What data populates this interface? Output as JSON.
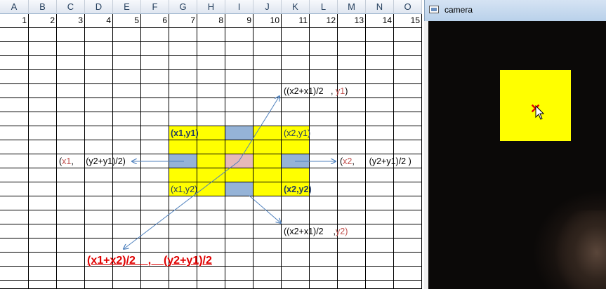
{
  "spreadsheet": {
    "columns": [
      "A",
      "B",
      "C",
      "D",
      "E",
      "F",
      "G",
      "H",
      "I",
      "J",
      "K",
      "L",
      "M",
      "N",
      "O"
    ],
    "row1_numbers": [
      "1",
      "2",
      "3",
      "4",
      "5",
      "6",
      "7",
      "8",
      "9",
      "10",
      "11",
      "12",
      "13",
      "14",
      "15"
    ],
    "labels": {
      "top_mid": "((x2+x1)/2",
      "top_mid_y": "y1",
      "top_mid_comma": ",",
      "left_mid_open": "(",
      "left_mid_x": "x1",
      "left_mid_rest": ",     (y2+y1)/2)",
      "right_mid_open": "(",
      "right_mid_x": "x2",
      "right_mid_rest": ",      (y2+y1)/2 )",
      "bottom_mid": "((x2+x1)/2",
      "bottom_mid_comma": ",",
      "bottom_mid_y": "y2)",
      "corner_tl": "(x1,y1)",
      "corner_tr": "(x2,y1)",
      "corner_bl": "(x1,y2)",
      "corner_br": "(x2,y2)",
      "center_formula": "(x1+x2)/2    ,    (y2+y1)/2"
    }
  },
  "camera_window": {
    "title": "camera",
    "marker": "✕",
    "square_color": "#ffff00",
    "marker_color": "#e00000"
  },
  "colors": {
    "yellow": "#ffff00",
    "blue": "#95b3d7",
    "pink": "#e6b9b8",
    "arrow": "#4f81bd"
  }
}
